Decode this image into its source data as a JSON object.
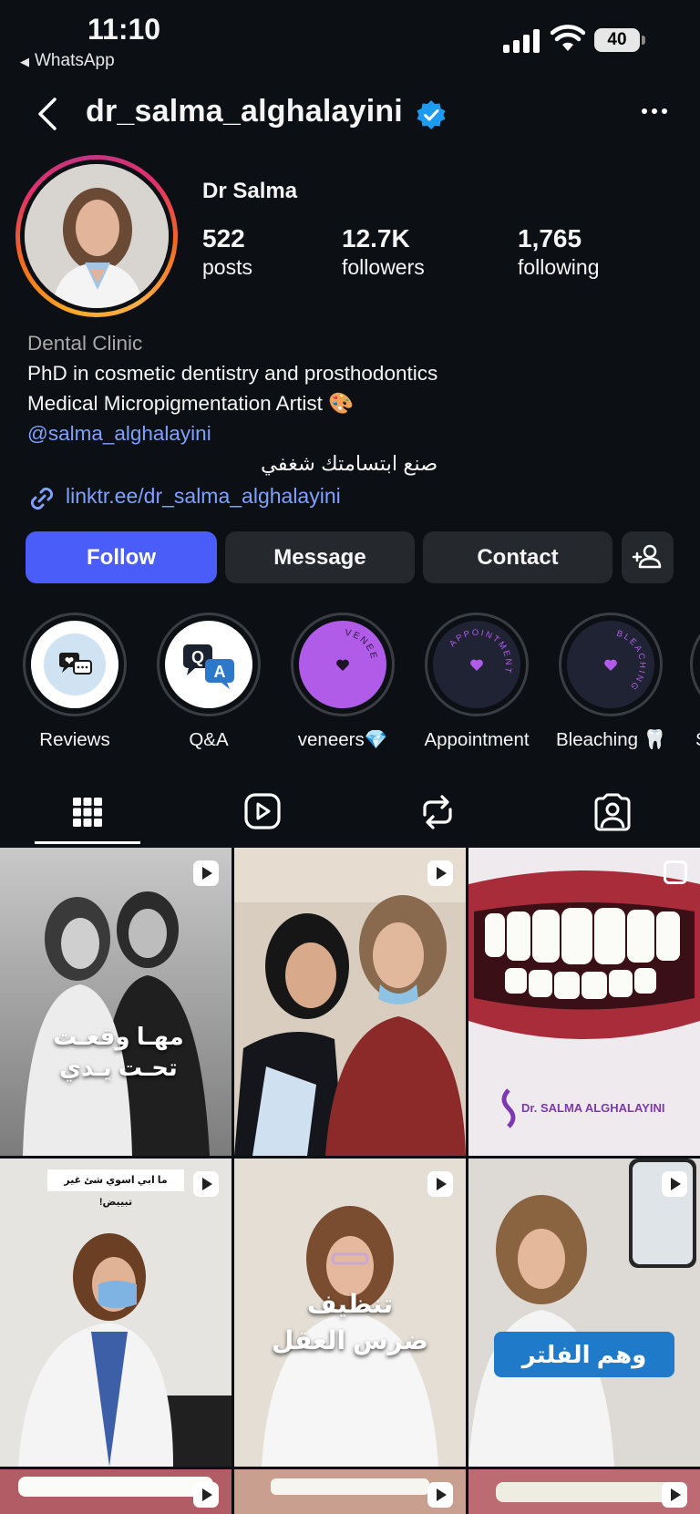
{
  "status_bar": {
    "time": "11:10",
    "back_app": "WhatsApp",
    "battery": "40"
  },
  "header": {
    "username": "dr_salma_alghalayini"
  },
  "profile": {
    "display_name": "Dr Salma",
    "stats": [
      {
        "value": "522",
        "label": "posts"
      },
      {
        "value": "12.7K",
        "label": "followers"
      },
      {
        "value": "1,765",
        "label": "following"
      }
    ],
    "category": "Dental Clinic",
    "bio_line1": "PhD in cosmetic dentistry and prosthodontics",
    "bio_line2": "Medical Micropigmentation Artist 🎨",
    "mention": "@salma_alghalayini",
    "bio_arabic": "صنع ابتسامتك شغفي",
    "link": "linktr.ee/dr_salma_alghalayini"
  },
  "actions": {
    "follow": "Follow",
    "message": "Message",
    "contact": "Contact"
  },
  "highlights": [
    {
      "label": "Reviews"
    },
    {
      "label": "Q&A"
    },
    {
      "label": "veneers💎",
      "ring_text": "VENEERS"
    },
    {
      "label": "Appointment",
      "ring_text": "APPOINTMENT"
    },
    {
      "label": "Bleaching 🦷",
      "ring_text": "BLEACHING"
    },
    {
      "label": "Sr"
    }
  ],
  "posts": {
    "p1_text_line1": "مهـا وقعـت",
    "p1_text_line2": "تحـت يـدي",
    "p3_watermark": "Dr. SALMA ALGHALAYINI",
    "p4_banner": "ما ابي اسوي شئ غير تبييض!",
    "p5_text_line1": "تنظيف",
    "p5_text_line2": "ضرس العقل",
    "p6_text": "وهم الفلتر"
  },
  "colors": {
    "accent": "#4a5df9",
    "link": "#7ea1ff",
    "background": "#0c1014",
    "button": "#25292e"
  }
}
